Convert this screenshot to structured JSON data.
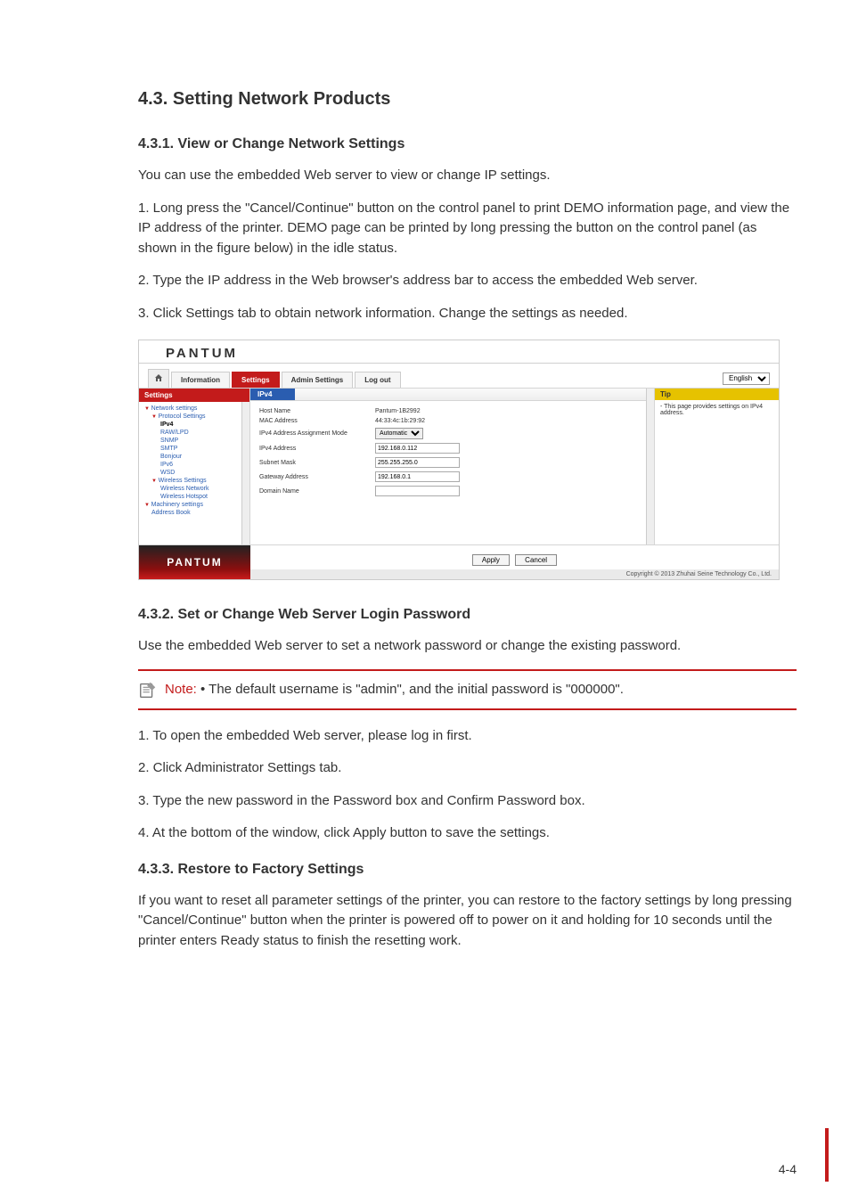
{
  "doc": {
    "h2": "4.3. Setting Network Products",
    "s1": {
      "h3": "4.3.1. View or Change Network Settings",
      "p1": "You can use the embedded Web server to view or change IP settings.",
      "p2": "1. Long press the \"Cancel/Continue\" button on the control panel to print DEMO information page, and view the IP address of the printer. DEMO page can be printed by long pressing the button on the control panel (as shown in the figure below) in the idle status.",
      "p3": "2. Type the IP address in the Web browser's address bar to access the embedded Web server.",
      "p4": "3. Click Settings tab to obtain network information. Change the settings as needed."
    },
    "s2": {
      "h3": "4.3.2. Set or Change Web Server Login Password",
      "p1": "Use the embedded Web server to set a network password or change the existing password.",
      "note_label": "Note: ",
      "note_text": "• The default username is \"admin\", and the initial password is \"000000\".",
      "p2": "1. To open the embedded Web server, please log in first.",
      "p3": "2. Click Administrator Settings tab.",
      "p4": "3. Type the new password in the Password box and Confirm Password box.",
      "p5": "4. At the bottom of the window, click Apply button to save the settings."
    },
    "s3": {
      "h3": "4.3.3. Restore to Factory Settings",
      "p1": "If you want to reset all parameter settings of the printer, you can restore to the factory settings by long pressing \"Cancel/Continue\" button when the printer is powered off to power on it and holding for 10 seconds until the printer enters Ready status to finish the resetting work."
    },
    "page_num": "4-4"
  },
  "ui": {
    "brand": "PANTUM",
    "tabs": {
      "information": "Information",
      "settings": "Settings",
      "admin": "Admin Settings",
      "logout": "Log out"
    },
    "lang": "English",
    "sidebar": {
      "header": "Settings",
      "network": "Network settings",
      "protocol": "Protocol Settings",
      "ipv4": "IPv4",
      "rawlpd": "RAW/LPD",
      "snmp": "SNMP",
      "smtp": "SMTP",
      "bonjour": "Bonjour",
      "ipv6": "IPv6",
      "wsd": "WSD",
      "wireless": "Wireless Settings",
      "wnet": "Wireless Network",
      "whot": "Wireless Hotspot",
      "machinery": "Machinery settings",
      "addr": "Address Book"
    },
    "form": {
      "tab": "IPv4",
      "host_lbl": "Host Name",
      "host_val": "Pantum-1B2992",
      "mac_lbl": "MAC Address",
      "mac_val": "44:33:4c:1b:29:92",
      "mode_lbl": "IPv4 Address Assignment Mode",
      "mode_val": "Automatic",
      "ip_lbl": "IPv4 Address",
      "ip_val": "192.168.0.112",
      "mask_lbl": "Subnet Mask",
      "mask_val": "255.255.255.0",
      "gw_lbl": "Gateway Address",
      "gw_val": "192.168.0.1",
      "dn_lbl": "Domain Name",
      "dn_val": ""
    },
    "tip": {
      "header": "Tip",
      "text": "- This page provides settings on IPv4 address."
    },
    "buttons": {
      "apply": "Apply",
      "cancel": "Cancel"
    },
    "copyright": "Copyright © 2013 Zhuhai Seine Technology Co., Ltd."
  }
}
